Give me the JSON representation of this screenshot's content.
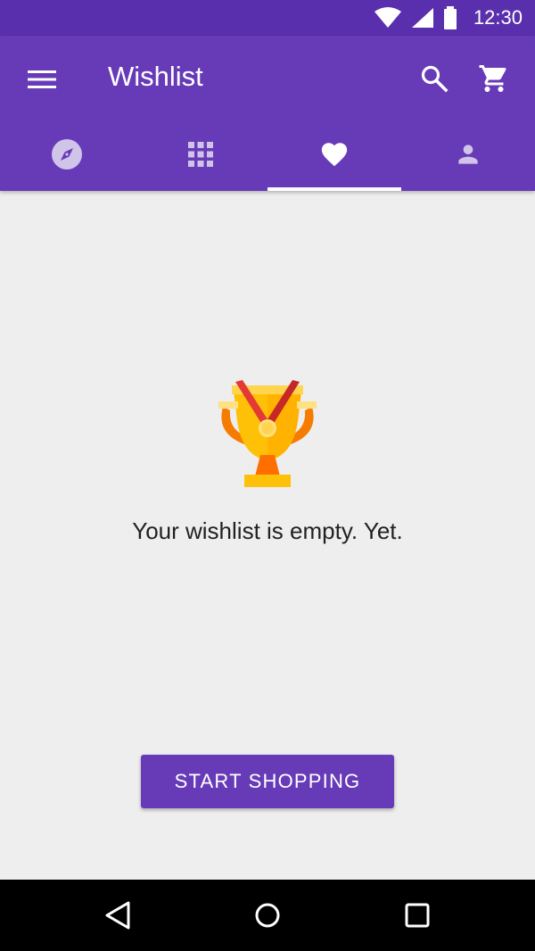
{
  "status_bar": {
    "time": "12:30",
    "icons": [
      "wifi-icon",
      "signal-icon",
      "battery-icon"
    ]
  },
  "app_bar": {
    "title": "Wishlist",
    "actions": [
      "search-icon",
      "cart-icon"
    ],
    "tabs": [
      {
        "icon": "compass-icon",
        "selected": false
      },
      {
        "icon": "grid-icon",
        "selected": false
      },
      {
        "icon": "heart-icon",
        "selected": true
      },
      {
        "icon": "person-icon",
        "selected": false
      }
    ]
  },
  "content": {
    "illustration": "trophy-icon",
    "empty_message": "Your wishlist is empty. Yet.",
    "cta_label": "START SHOPPING"
  },
  "nav_bar": {
    "buttons": [
      "back-icon",
      "home-icon",
      "recents-icon"
    ]
  },
  "colors": {
    "primary": "#673ab7",
    "primary_dark": "#5a2fae",
    "background": "#eeeeee",
    "trophy_gold": "#ffc107",
    "ribbon_red": "#e53935"
  }
}
